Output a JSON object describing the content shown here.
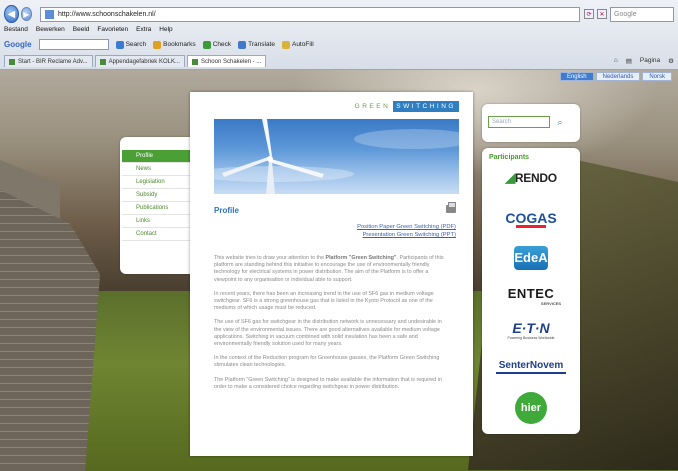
{
  "browser": {
    "url": "http://www.schoonschakelen.nl/",
    "search_placeholder": "Google",
    "menu": [
      "Bestand",
      "Bewerken",
      "Beeld",
      "Favorieten",
      "Extra",
      "Help"
    ],
    "toolbar": {
      "google": "Google",
      "search": "Search",
      "bookmarks": "Bookmarks",
      "check": "Check",
      "translate": "Translate",
      "autofill": "AutoFill"
    },
    "tabs": [
      "Start - BIR Reclame Adv...",
      "Appendagefabriek KOLK...",
      "Schoon Schakelen - ..."
    ],
    "page_menu": "Pagina"
  },
  "site": {
    "languages": [
      "English",
      "Nederlands",
      "Norsk"
    ],
    "brand": {
      "green": "GREEN",
      "switching": "SWITCHING"
    },
    "nav": [
      "Profile",
      "News",
      "Legislation",
      "Subsidy",
      "Publications",
      "Links",
      "Contact"
    ],
    "page_title": "Profile",
    "links": [
      "Position Paper Green Switching (PDF)",
      "Presentation Green Switching (PPT)"
    ],
    "paragraphs": [
      {
        "lead": "This website tries to draw your attention to the ",
        "bold": "Platform \"Green Switching\"",
        "rest": ". Participants of this platform are standing behind this initiative to encourage the use of environmentally friendly technology for electrical systems in power distribution. The aim of the Platform is to offer a viewpoint to any organisation or individual able to support."
      },
      {
        "lead": "In recent years, there has been an increasing trend in the use of SF6 gas in medium voltage switchgear. SF6 is a strong greenhouse gas that is listed in the Kyoto Protocol as one of the mediums of which usage must be reduced.",
        "bold": "",
        "rest": ""
      },
      {
        "lead": "The use of SF6 gas for switchgear in the distribution network is unnecessary and undesirable in the view of the environmental issues. There are good alternatives available for medium voltage applications. Switching in vacuum combined with solid insulation has been a safe and environmentally friendly solution used for many years.",
        "bold": "",
        "rest": ""
      },
      {
        "lead": "In the context of the Reduction program for Greenhouse gasses, the Platform Green Switching stimulates clean technologies.",
        "bold": "",
        "rest": ""
      },
      {
        "lead": "The Platform \"Green Switching\" is designed to make available the information that is required in order to make a considered choice regarding switchgear in power distribution.",
        "bold": "",
        "rest": ""
      }
    ],
    "search_placeholder": "Search",
    "participants_title": "Participants",
    "participants": {
      "rendo": "RENDO",
      "cogas": "COGAS",
      "edea": "EdeA",
      "entec": "ENTEC",
      "entec_sub": "SERVICES",
      "eaton": "E·T·N",
      "eaton_tag": "Powering Business Worldwide",
      "senter": "SenterNovem",
      "hier": "hier"
    }
  }
}
